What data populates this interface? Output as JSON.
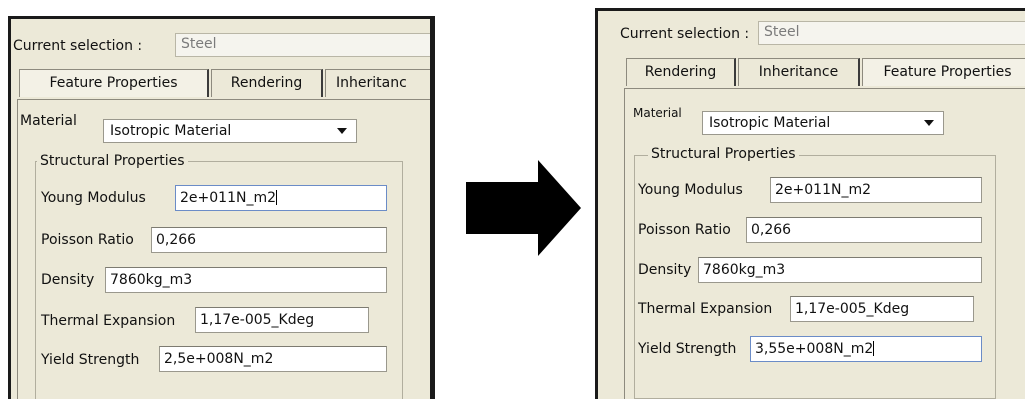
{
  "left": {
    "current_selection_label": "Current selection :",
    "current_selection_value": "Steel",
    "tabs": [
      "Feature Properties",
      "Rendering",
      "Inheritanc"
    ],
    "material_label": "Material",
    "material_value": "Isotropic Material",
    "group_title": "Structural Properties",
    "fields": [
      {
        "label": "Young Modulus",
        "value": "2e+011N_m2"
      },
      {
        "label": "Poisson Ratio",
        "value": "0,266"
      },
      {
        "label": "Density",
        "value": "7860kg_m3"
      },
      {
        "label": "Thermal Expansion",
        "value": "1,17e-005_Kdeg"
      },
      {
        "label": "Yield Strength",
        "value": "2,5e+008N_m2"
      }
    ]
  },
  "right": {
    "current_selection_label": "Current selection :",
    "current_selection_value": "Steel",
    "tabs": [
      "Rendering",
      "Inheritance",
      "Feature Properties"
    ],
    "material_label": "Material",
    "material_value": "Isotropic Material",
    "group_title": "Structural Properties",
    "fields": [
      {
        "label": "Young Modulus",
        "value": "2e+011N_m2"
      },
      {
        "label": "Poisson Ratio",
        "value": "0,266"
      },
      {
        "label": "Density",
        "value": "7860kg_m3"
      },
      {
        "label": "Thermal Expansion",
        "value": "1,17e-005_Kdeg"
      },
      {
        "label": "Yield Strength",
        "value": "3,55e+008N_m2"
      }
    ]
  },
  "colors": {
    "panel_bg": "#ece9d8",
    "arrow": "#000000",
    "focus_border": "#6b8cc7"
  },
  "icons": {
    "arrow": "right-arrow-icon",
    "dropdown": "chevron-down-icon"
  }
}
